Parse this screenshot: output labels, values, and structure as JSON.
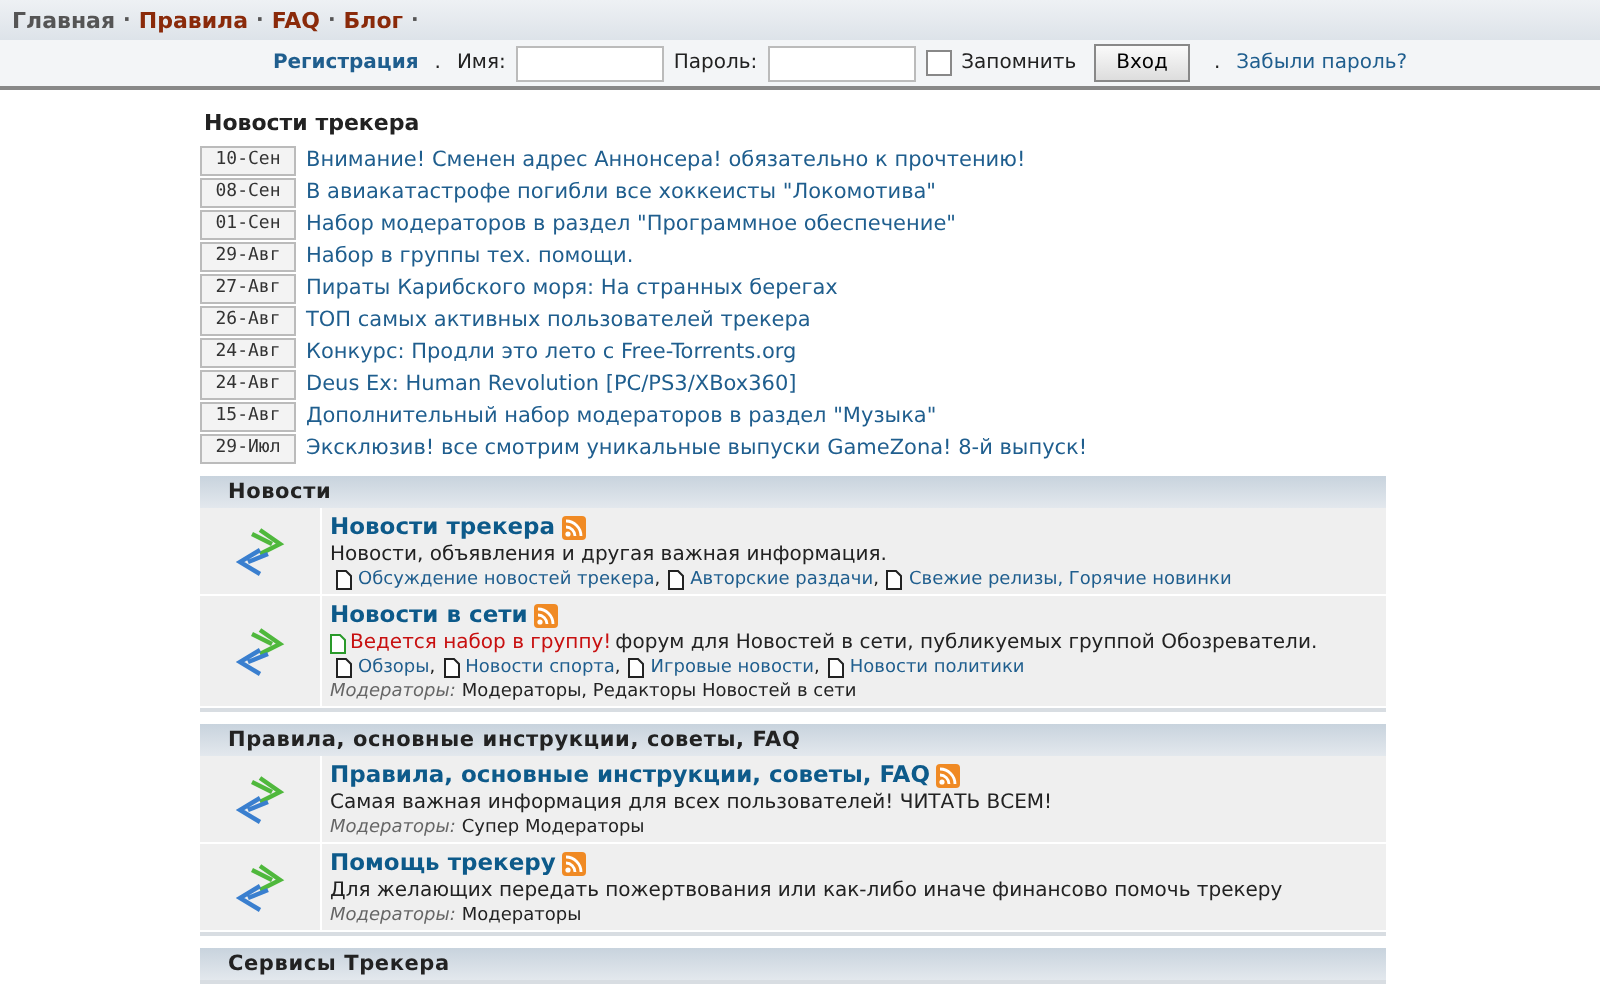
{
  "nav": [
    {
      "label": "Главная",
      "selected": true
    },
    {
      "label": "Правила",
      "selected": false
    },
    {
      "label": "FAQ",
      "selected": false
    },
    {
      "label": "Блог",
      "selected": false
    }
  ],
  "nav_separator": "·",
  "login": {
    "register": "Регистрация",
    "separator": ".",
    "name_label": "Имя:",
    "password_label": "Пароль:",
    "remember": {
      "label": "Запомнить",
      "checked": false
    },
    "button": "Вход",
    "forgot": "Забыли пароль?"
  },
  "news": {
    "title": "Новости трекера",
    "items": [
      {
        "date": "10-Сен",
        "title": "Внимание! Сменен адрес Аннонсера! обязательно к прочтению!"
      },
      {
        "date": "08-Сен",
        "title": "В авиакатастрофе погибли все хоккеисты \"Локомотива\""
      },
      {
        "date": "01-Сен",
        "title": "Набор модераторов в раздел \"Программное обеспечение\""
      },
      {
        "date": "29-Авг",
        "title": "Набор в группы тех. помощи."
      },
      {
        "date": "27-Авг",
        "title": "Пираты Карибского моря: На странных берегах"
      },
      {
        "date": "26-Авг",
        "title": "ТОП самых активных пользователей трекера"
      },
      {
        "date": "24-Авг",
        "title": "Конкурс: Продли это лето с Free-Torrents.org"
      },
      {
        "date": "24-Авг",
        "title": "Deus Ex: Human Revolution [PC/PS3/XBox360]"
      },
      {
        "date": "15-Авг",
        "title": "Дополнительный набор модераторов в раздел \"Музыка\""
      },
      {
        "date": "29-Июл",
        "title": "Эксклюзив! все смотрим уникальные выпуски GameZona! 8-й выпуск!"
      }
    ]
  },
  "sections": [
    {
      "title": "Новости",
      "forums": [
        {
          "title": "Новости трекера",
          "rss": true,
          "description": "Новости, объявления и другая важная информация.",
          "subforums": [
            "Обсуждение новостей трекера",
            "Авторские раздачи",
            "Свежие релизы, Горячие новинки"
          ]
        },
        {
          "title": "Новости в сети",
          "rss": true,
          "notice": "Ведется набор в группу!",
          "description": "форум для Новостей в сети, публикуемых группой Обозреватели.",
          "subforums": [
            "Обзоры",
            "Новости спорта",
            "Игровые новости",
            "Новости политики"
          ],
          "moderators_label": "Модераторы:",
          "moderators": "Модераторы, Редакторы Новостей в сети"
        }
      ]
    },
    {
      "title": "Правила, основные инструкции, советы, FAQ",
      "forums": [
        {
          "title": "Правила, основные инструкции, советы, FAQ",
          "rss": true,
          "description": "Самая важная информация для всех пользователей! ЧИТАТЬ ВСЕМ!",
          "moderators_label": "Модераторы:",
          "moderators": "Супер Модераторы"
        },
        {
          "title": "Помощь трекеру",
          "rss": true,
          "description": "Для желающих передать пожертвования или как-либо иначе финансово помочь трекеру",
          "moderators_label": "Модераторы:",
          "moderators": "Модераторы"
        }
      ]
    },
    {
      "title": "Сервисы Трекера"
    }
  ],
  "subforum_separator": ","
}
